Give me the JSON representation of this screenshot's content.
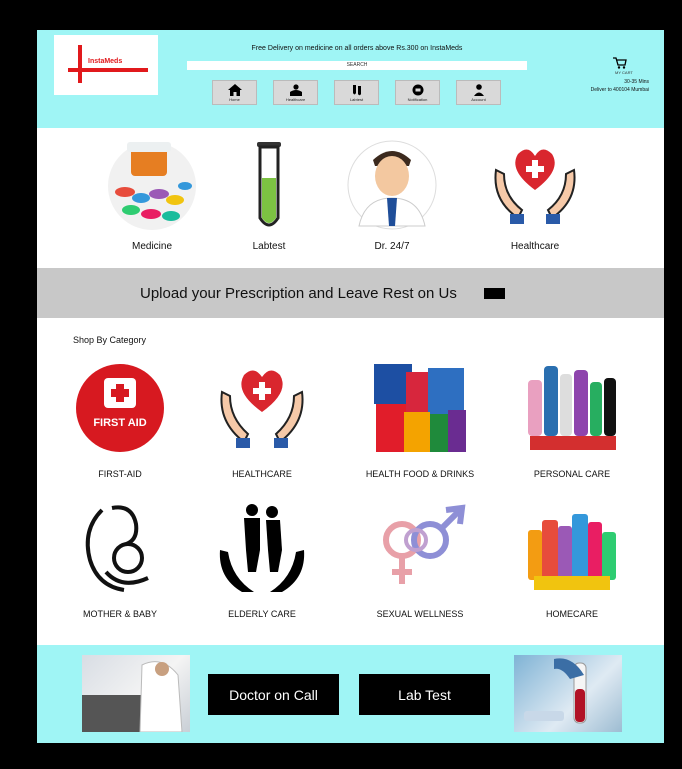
{
  "header": {
    "logo_text": "InstaMeds",
    "promo": "Free Delivery on  medicine on all orders above Rs.300 on InstaMeds",
    "search_label": "SEARCH",
    "nav": [
      {
        "label": "Home",
        "icon": "home-icon"
      },
      {
        "label": "Healthcare",
        "icon": "healthcare-icon"
      },
      {
        "label": "Labtest",
        "icon": "labtest-icon"
      },
      {
        "label": "Notification",
        "icon": "notification-icon"
      },
      {
        "label": "Account",
        "icon": "account-icon"
      }
    ],
    "cart_label": "MY CART",
    "delivery_time": "30-35 Mins",
    "delivery_to": "Deliver to 400104 Mumbai"
  },
  "top_categories": [
    "Medicine",
    "Labtest",
    "Dr. 24/7",
    "Healthcare"
  ],
  "upload": {
    "text": "Upload your Prescription and Leave Rest on Us"
  },
  "shop": {
    "title": "Shop By Category",
    "items": [
      "FIRST-AID",
      "HEALTHCARE",
      "HEALTH FOOD & DRINKS",
      "PERSONAL CARE",
      "MOTHER & BABY",
      "ELDERLY CARE",
      "SEXUAL WELLNESS",
      "HOMECARE"
    ],
    "first_aid_text": "FIRST AID"
  },
  "bottom": {
    "doctor_on_call": "Doctor on Call",
    "lab_test": "Lab Test"
  },
  "colors": {
    "header_bg": "#9ff5f5",
    "accent_red": "#e1191c",
    "banner_gray": "#c8c8c8"
  }
}
